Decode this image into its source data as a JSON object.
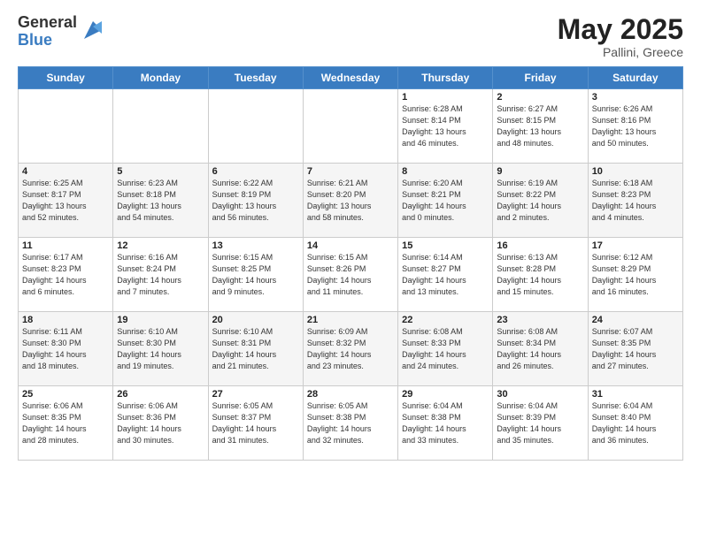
{
  "header": {
    "logo_general": "General",
    "logo_blue": "Blue",
    "month_year": "May 2025",
    "location": "Pallini, Greece"
  },
  "weekdays": [
    "Sunday",
    "Monday",
    "Tuesday",
    "Wednesday",
    "Thursday",
    "Friday",
    "Saturday"
  ],
  "weeks": [
    [
      {
        "day": "",
        "info": ""
      },
      {
        "day": "",
        "info": ""
      },
      {
        "day": "",
        "info": ""
      },
      {
        "day": "",
        "info": ""
      },
      {
        "day": "1",
        "info": "Sunrise: 6:28 AM\nSunset: 8:14 PM\nDaylight: 13 hours\nand 46 minutes."
      },
      {
        "day": "2",
        "info": "Sunrise: 6:27 AM\nSunset: 8:15 PM\nDaylight: 13 hours\nand 48 minutes."
      },
      {
        "day": "3",
        "info": "Sunrise: 6:26 AM\nSunset: 8:16 PM\nDaylight: 13 hours\nand 50 minutes."
      }
    ],
    [
      {
        "day": "4",
        "info": "Sunrise: 6:25 AM\nSunset: 8:17 PM\nDaylight: 13 hours\nand 52 minutes."
      },
      {
        "day": "5",
        "info": "Sunrise: 6:23 AM\nSunset: 8:18 PM\nDaylight: 13 hours\nand 54 minutes."
      },
      {
        "day": "6",
        "info": "Sunrise: 6:22 AM\nSunset: 8:19 PM\nDaylight: 13 hours\nand 56 minutes."
      },
      {
        "day": "7",
        "info": "Sunrise: 6:21 AM\nSunset: 8:20 PM\nDaylight: 13 hours\nand 58 minutes."
      },
      {
        "day": "8",
        "info": "Sunrise: 6:20 AM\nSunset: 8:21 PM\nDaylight: 14 hours\nand 0 minutes."
      },
      {
        "day": "9",
        "info": "Sunrise: 6:19 AM\nSunset: 8:22 PM\nDaylight: 14 hours\nand 2 minutes."
      },
      {
        "day": "10",
        "info": "Sunrise: 6:18 AM\nSunset: 8:23 PM\nDaylight: 14 hours\nand 4 minutes."
      }
    ],
    [
      {
        "day": "11",
        "info": "Sunrise: 6:17 AM\nSunset: 8:23 PM\nDaylight: 14 hours\nand 6 minutes."
      },
      {
        "day": "12",
        "info": "Sunrise: 6:16 AM\nSunset: 8:24 PM\nDaylight: 14 hours\nand 7 minutes."
      },
      {
        "day": "13",
        "info": "Sunrise: 6:15 AM\nSunset: 8:25 PM\nDaylight: 14 hours\nand 9 minutes."
      },
      {
        "day": "14",
        "info": "Sunrise: 6:15 AM\nSunset: 8:26 PM\nDaylight: 14 hours\nand 11 minutes."
      },
      {
        "day": "15",
        "info": "Sunrise: 6:14 AM\nSunset: 8:27 PM\nDaylight: 14 hours\nand 13 minutes."
      },
      {
        "day": "16",
        "info": "Sunrise: 6:13 AM\nSunset: 8:28 PM\nDaylight: 14 hours\nand 15 minutes."
      },
      {
        "day": "17",
        "info": "Sunrise: 6:12 AM\nSunset: 8:29 PM\nDaylight: 14 hours\nand 16 minutes."
      }
    ],
    [
      {
        "day": "18",
        "info": "Sunrise: 6:11 AM\nSunset: 8:30 PM\nDaylight: 14 hours\nand 18 minutes."
      },
      {
        "day": "19",
        "info": "Sunrise: 6:10 AM\nSunset: 8:30 PM\nDaylight: 14 hours\nand 19 minutes."
      },
      {
        "day": "20",
        "info": "Sunrise: 6:10 AM\nSunset: 8:31 PM\nDaylight: 14 hours\nand 21 minutes."
      },
      {
        "day": "21",
        "info": "Sunrise: 6:09 AM\nSunset: 8:32 PM\nDaylight: 14 hours\nand 23 minutes."
      },
      {
        "day": "22",
        "info": "Sunrise: 6:08 AM\nSunset: 8:33 PM\nDaylight: 14 hours\nand 24 minutes."
      },
      {
        "day": "23",
        "info": "Sunrise: 6:08 AM\nSunset: 8:34 PM\nDaylight: 14 hours\nand 26 minutes."
      },
      {
        "day": "24",
        "info": "Sunrise: 6:07 AM\nSunset: 8:35 PM\nDaylight: 14 hours\nand 27 minutes."
      }
    ],
    [
      {
        "day": "25",
        "info": "Sunrise: 6:06 AM\nSunset: 8:35 PM\nDaylight: 14 hours\nand 28 minutes."
      },
      {
        "day": "26",
        "info": "Sunrise: 6:06 AM\nSunset: 8:36 PM\nDaylight: 14 hours\nand 30 minutes."
      },
      {
        "day": "27",
        "info": "Sunrise: 6:05 AM\nSunset: 8:37 PM\nDaylight: 14 hours\nand 31 minutes."
      },
      {
        "day": "28",
        "info": "Sunrise: 6:05 AM\nSunset: 8:38 PM\nDaylight: 14 hours\nand 32 minutes."
      },
      {
        "day": "29",
        "info": "Sunrise: 6:04 AM\nSunset: 8:38 PM\nDaylight: 14 hours\nand 33 minutes."
      },
      {
        "day": "30",
        "info": "Sunrise: 6:04 AM\nSunset: 8:39 PM\nDaylight: 14 hours\nand 35 minutes."
      },
      {
        "day": "31",
        "info": "Sunrise: 6:04 AM\nSunset: 8:40 PM\nDaylight: 14 hours\nand 36 minutes."
      }
    ]
  ]
}
